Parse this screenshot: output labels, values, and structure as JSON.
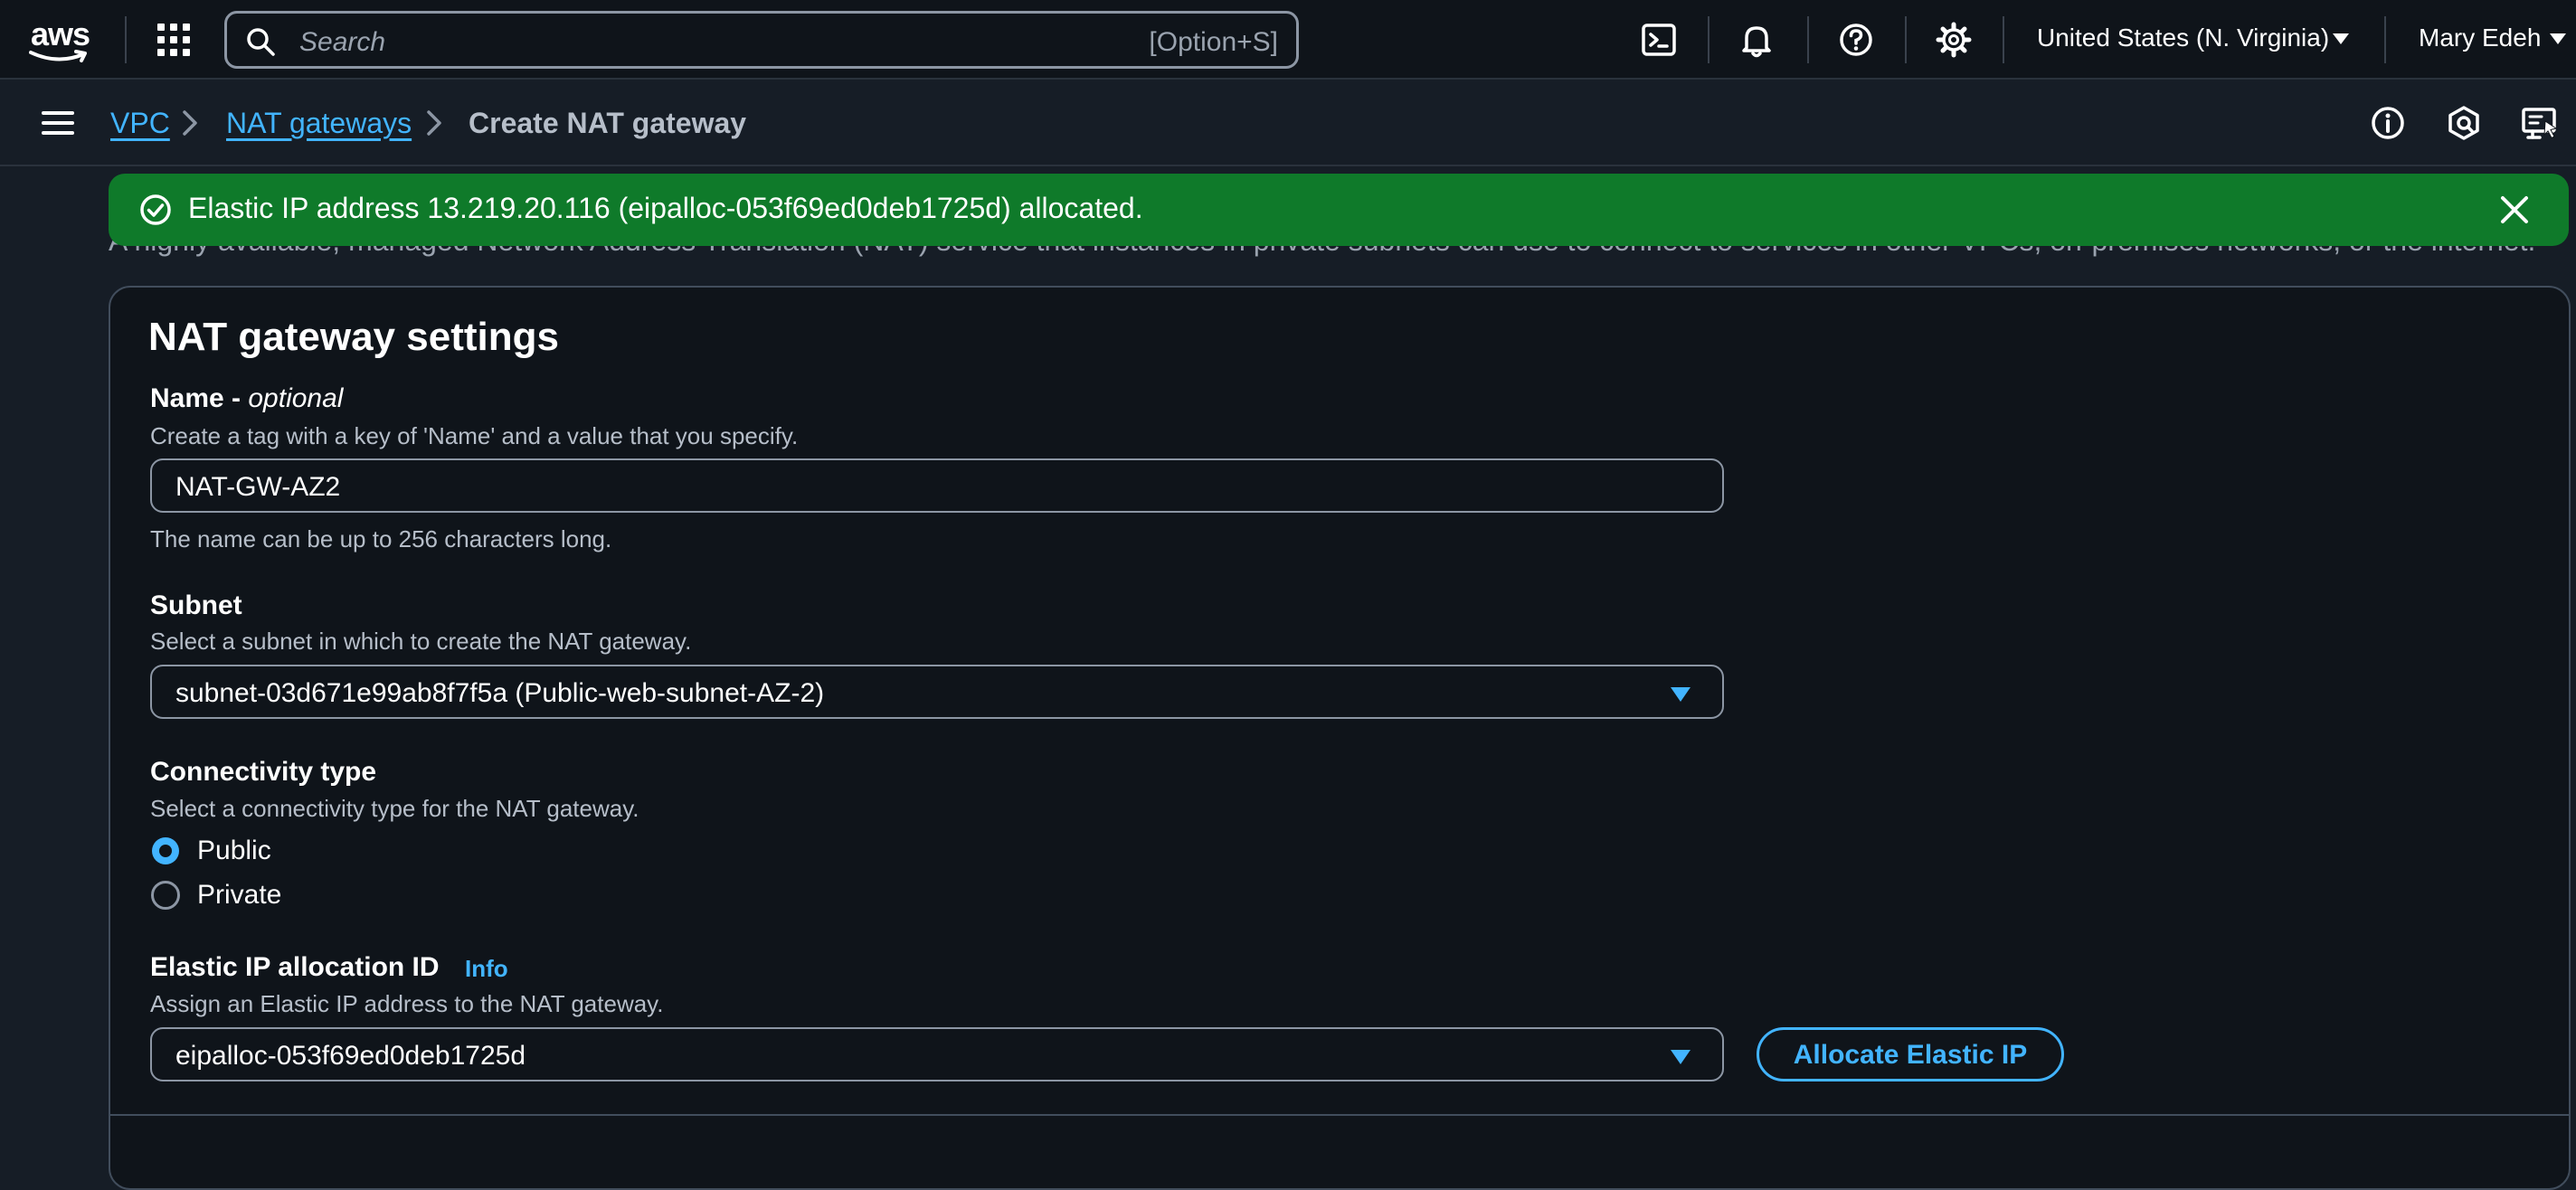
{
  "topnav": {
    "logo_text": "aws",
    "search_placeholder": "Search",
    "search_shortcut": "[Option+S]",
    "region": "United States (N. Virginia)",
    "user": "Mary Edeh",
    "icons": [
      "grid-icon",
      "cloudshell-icon",
      "bell-icon",
      "help-icon",
      "gear-icon"
    ]
  },
  "breadcrumb": {
    "items": [
      {
        "label": "VPC",
        "link": true
      },
      {
        "label": "NAT gateways",
        "link": true
      },
      {
        "label": "Create NAT gateway",
        "link": false
      }
    ],
    "right_icons": [
      "info-circle-icon",
      "hexagon-icon",
      "display-feedback-icon"
    ]
  },
  "flash": {
    "message": "Elastic IP address 13.219.20.116 (eipalloc-053f69ed0deb1725d) allocated."
  },
  "page_description": "A highly available, managed Network Address Translation (NAT) service that instances in private subnets can use to connect to services in other VPCs, on-premises networks, or the internet.",
  "settings": {
    "title": "NAT gateway settings",
    "name": {
      "label": "Name - ",
      "label_optional": "optional",
      "hint": "Create a tag with a key of 'Name' and a value that you specify.",
      "value": "NAT-GW-AZ2",
      "constraint": "The name can be up to 256 characters long."
    },
    "subnet": {
      "label": "Subnet",
      "hint": "Select a subnet in which to create the NAT gateway.",
      "value": "subnet-03d671e99ab8f7f5a (Public-web-subnet-AZ-2)"
    },
    "connectivity": {
      "label": "Connectivity type",
      "hint": "Select a connectivity type for the NAT gateway.",
      "options": [
        "Public",
        "Private"
      ],
      "selected": "Public"
    },
    "eip": {
      "label": "Elastic IP allocation ID",
      "info": "Info",
      "hint": "Assign an Elastic IP address to the NAT gateway.",
      "value": "eipalloc-053f69ed0deb1725d",
      "button": "Allocate Elastic IP"
    }
  },
  "colors": {
    "background": "#161d26",
    "panel": "#0f141a",
    "link": "#42b4ff",
    "success": "#0f7a2a"
  }
}
